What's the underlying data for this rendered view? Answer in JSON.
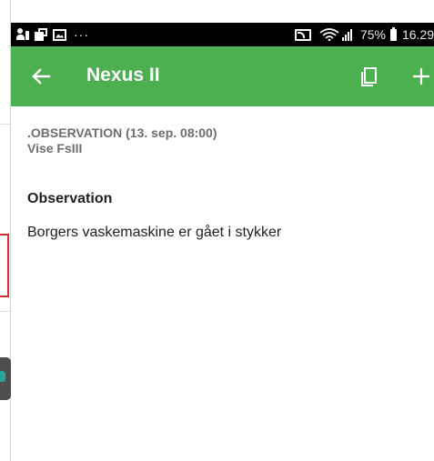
{
  "status_bar": {
    "overflow_indicator": "···",
    "battery_percent": "75%",
    "time": "16.29",
    "icons": [
      "user-icon",
      "copy-icon",
      "image-icon",
      "cast-icon",
      "wifi-icon",
      "signal-icon",
      "battery-icon"
    ]
  },
  "app_bar": {
    "title": "Nexus II",
    "color": "#4caf50",
    "back_icon": "arrow-left-icon",
    "copy_icon": "copy-icon",
    "add_icon": "plus-icon"
  },
  "observation": {
    "meta_line": ".OBSERVATION (13. sep. 08:00)",
    "author": "Vise FsIII",
    "section_heading": "Observation",
    "text": "Borgers vaskemaskine er gået i stykker"
  }
}
